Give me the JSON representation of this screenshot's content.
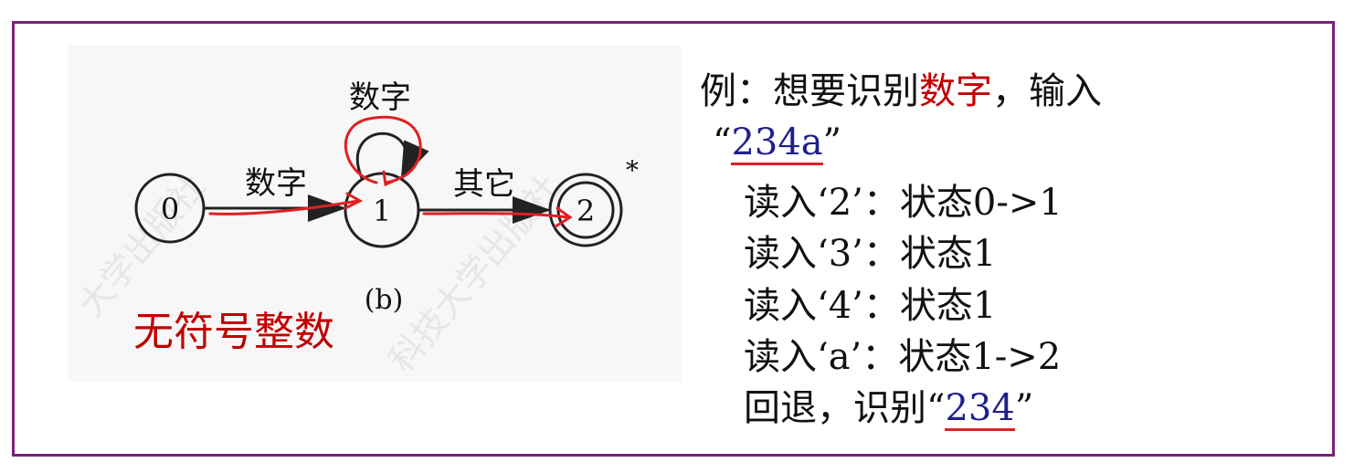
{
  "colors": {
    "frame": "#7b1f7a",
    "highlight_red": "#c00000",
    "highlight_blue": "#1f1f8c",
    "annotation_red": "#e02020"
  },
  "diagram": {
    "states": [
      "0",
      "1",
      "2"
    ],
    "accept_marker": "*",
    "self_loop_label": "数字",
    "edge_0_1_label": "数字",
    "edge_1_2_label": "其它",
    "figure_label": "(b)",
    "watermark_left": "大学出版社",
    "watermark_right": "科技大学出版社",
    "caption": "无符号整数"
  },
  "example": {
    "line1_prefix": "例：想要识别",
    "line1_highlight": "数字",
    "line1_suffix": "，输入",
    "line2_open_quote": "“",
    "line2_input": "234a",
    "line2_close_quote": "”",
    "steps": [
      "读入‘2’：状态0->1",
      "读入‘3’：状态1",
      "读入‘4’：状态1",
      "读入‘a’：状态1->2"
    ],
    "result_prefix": "回退，识别“",
    "result_value": "234",
    "result_suffix": "”"
  }
}
